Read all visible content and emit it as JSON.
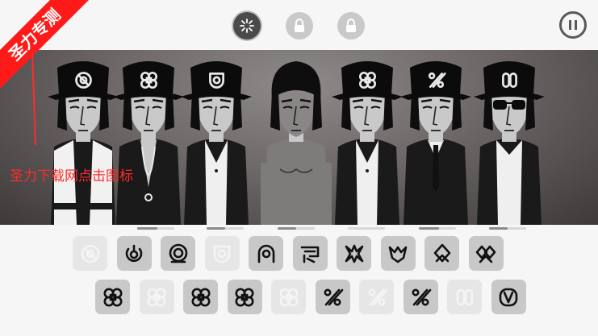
{
  "watermark": {
    "ribbon": "圣力专测",
    "caption": "圣力下载网点击图标"
  },
  "top_bar": {
    "mode_buttons": [
      {
        "icon": "sparkle-icon",
        "state": "active"
      },
      {
        "icon": "lock-icon",
        "state": "locked"
      },
      {
        "icon": "lock-icon",
        "state": "locked"
      }
    ],
    "pause_icon": "pause-icon"
  },
  "characters": [
    {
      "hat_icon": "target-circle",
      "outfit": "white-jacket",
      "mic": "none"
    },
    {
      "hat_icon": "clover",
      "outfit": "open-shirt-necklace",
      "mic": "none"
    },
    {
      "hat_icon": "shield-ring",
      "outfit": "white-vest",
      "mic": "none"
    },
    {
      "hat_icon": "none",
      "outfit": "shirtless",
      "mic": "none"
    },
    {
      "hat_icon": "clover",
      "outfit": "white-shirt-vest",
      "mic": "none"
    },
    {
      "hat_icon": "percent-cross",
      "outfit": "black-suit-tie",
      "mic": "none"
    },
    {
      "hat_icon": "double-bar",
      "outfit": "sunglasses-jacket",
      "mic": "none"
    }
  ],
  "character_sliders": [
    {
      "level": 0.55
    },
    {
      "level": 0.5
    },
    {
      "level": 0.5
    },
    {
      "level": 0.0
    },
    {
      "level": 0.55
    },
    {
      "level": 0.5
    },
    {
      "level": 0.5
    }
  ],
  "sound_icons": {
    "row1": [
      {
        "icon": "target-circle",
        "enabled": false
      },
      {
        "icon": "horseshoe",
        "enabled": true
      },
      {
        "icon": "double-ring",
        "enabled": true
      },
      {
        "icon": "shield-ring",
        "enabled": false
      },
      {
        "icon": "arch-ring",
        "enabled": true
      },
      {
        "icon": "banner",
        "enabled": true
      },
      {
        "icon": "burst",
        "enabled": true
      },
      {
        "icon": "crown-drop",
        "enabled": true
      },
      {
        "icon": "diamond-loop",
        "enabled": true
      },
      {
        "icon": "twin-diamond",
        "enabled": true
      }
    ],
    "row2": [
      {
        "icon": "clover",
        "enabled": true
      },
      {
        "icon": "clover-outline",
        "enabled": false
      },
      {
        "icon": "clover",
        "enabled": true
      },
      {
        "icon": "clover",
        "enabled": true
      },
      {
        "icon": "clover-outline",
        "enabled": false
      },
      {
        "icon": "percent-cross",
        "enabled": true
      },
      {
        "icon": "percent-cross",
        "enabled": false
      },
      {
        "icon": "percent-cross",
        "enabled": true
      },
      {
        "icon": "double-bar",
        "enabled": false
      },
      {
        "icon": "double-bar-fill",
        "enabled": true
      }
    ]
  }
}
